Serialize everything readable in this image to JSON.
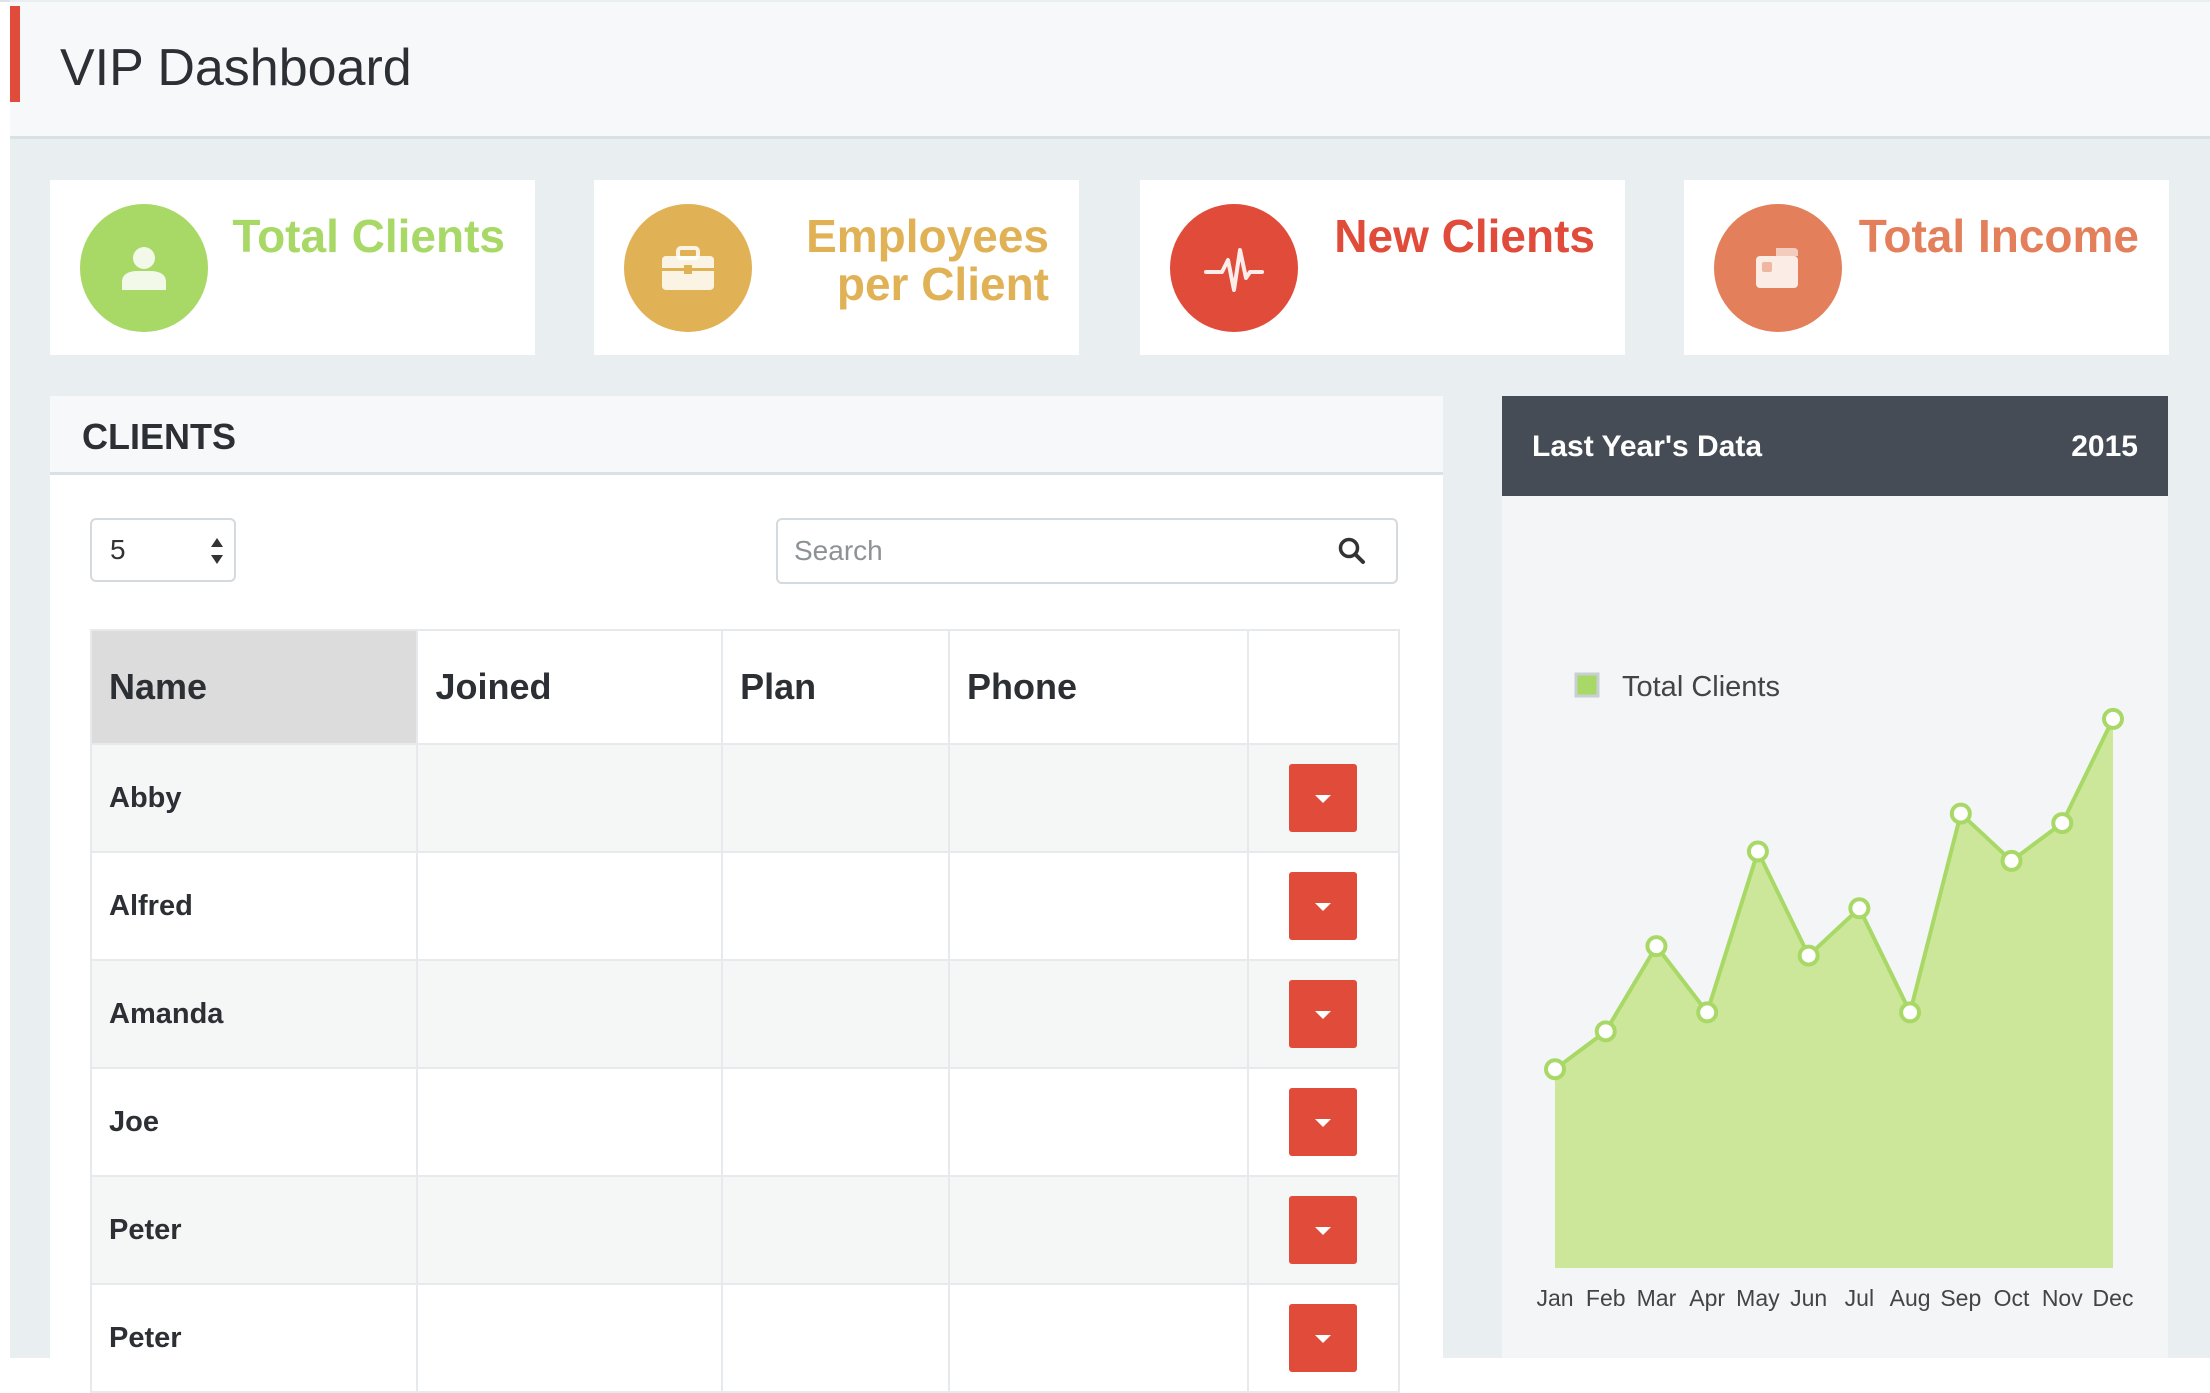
{
  "header": {
    "title": "VIP Dashboard"
  },
  "stats": [
    {
      "label": "Total Clients",
      "color": "#a8d866",
      "icon": "user-icon"
    },
    {
      "label_line1": "Employees",
      "label_line2": "per Client",
      "color": "#e0b255",
      "icon": "briefcase-icon"
    },
    {
      "label": "New Clients",
      "color": "#e04b3a",
      "icon": "pulse-icon"
    },
    {
      "label": "Total Income",
      "color": "#e37f5a",
      "icon": "wallet-icon"
    }
  ],
  "clients": {
    "title": "CLIENTS",
    "page_size": "5",
    "search_placeholder": "Search",
    "columns": [
      "Name",
      "Joined",
      "Plan",
      "Phone"
    ],
    "rows": [
      {
        "name": "Abby"
      },
      {
        "name": "Alfred"
      },
      {
        "name": "Amanda"
      },
      {
        "name": "Joe"
      },
      {
        "name": "Peter"
      },
      {
        "name": "Peter"
      }
    ]
  },
  "chart_panel": {
    "title": "Last Year's Data",
    "year": "2015"
  },
  "chart_data": {
    "type": "area",
    "categories": [
      "Jan",
      "Feb",
      "Mar",
      "Apr",
      "May",
      "Jun",
      "Jul",
      "Aug",
      "Sep",
      "Oct",
      "Nov",
      "Dec"
    ],
    "series": [
      {
        "name": "Total Clients",
        "values": [
          21,
          25,
          34,
          27,
          44,
          33,
          38,
          27,
          48,
          43,
          47,
          58
        ],
        "color": "#a8d866"
      }
    ],
    "ylim": [
      0,
      75
    ],
    "grid": false,
    "legend": "top-left"
  }
}
